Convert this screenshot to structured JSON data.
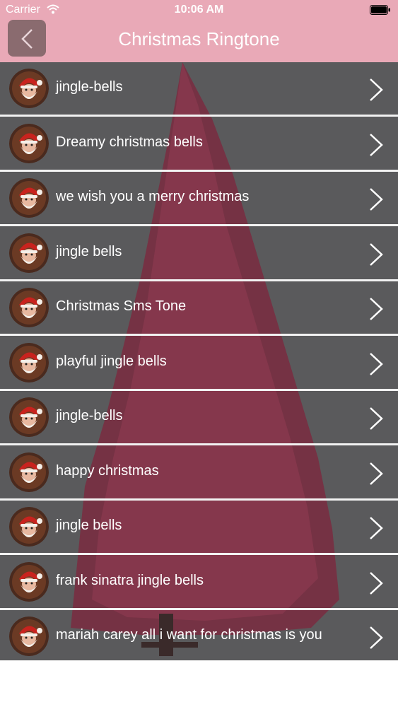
{
  "status_bar": {
    "carrier": "Carrier",
    "time": "10:06 AM",
    "wifi_icon": "wifi-icon",
    "battery_icon": "battery-icon"
  },
  "nav_bar": {
    "title": "Christmas Ringtone",
    "back_icon": "chevron-left-icon"
  },
  "colors": {
    "nav_background": "#e9a9b7",
    "list_background": "#5a5a5c",
    "tree": "#7a2b3f",
    "separator": "#f2f2f2"
  },
  "ringtones": [
    {
      "label": "jingle-bells"
    },
    {
      "label": "Dreamy christmas bells"
    },
    {
      "label": "we wish you a merry christmas"
    },
    {
      "label": "jingle bells"
    },
    {
      "label": "Christmas Sms Tone"
    },
    {
      "label": "playful jingle bells"
    },
    {
      "label": "jingle-bells"
    },
    {
      "label": "happy christmas"
    },
    {
      "label": "jingle bells"
    },
    {
      "label": "frank sinatra jingle bells"
    },
    {
      "label": "mariah carey all i want for christmas is you"
    }
  ],
  "row_icons": {
    "avatar": "santa-avatar-icon",
    "chevron": "chevron-right-icon"
  }
}
